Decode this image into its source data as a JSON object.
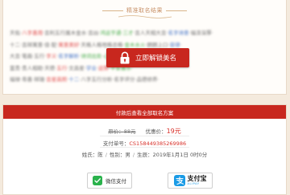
{
  "result": {
    "title": "精准取名结果",
    "blurred_lines": [
      [
        {
          "t": "天佑·",
          "c": ""
        },
        {
          "t": "八字喜用",
          "c": "r"
        },
        {
          "t": "·吉利五行属木金水·吉凶·",
          "c": ""
        },
        {
          "t": "鸿运亨通·三才",
          "c": "g"
        },
        {
          "t": "·吉人天相大吉·",
          "c": ""
        },
        {
          "t": "名字诗意",
          "c": "b"
        },
        {
          "t": "·福泽深厚·",
          "c": ""
        }
      ],
      [
        {
          "t": "十二·吉祥寓意·佳·配·",
          "c": ""
        },
        {
          "t": "寓意美好",
          "c": "r"
        },
        {
          "t": "·天格人格地格总格·",
          "c": ""
        },
        {
          "t": "金木水火",
          "c": "g"
        },
        {
          "t": "·朗朗上口·",
          "c": ""
        },
        {
          "t": "音律",
          "c": "b"
        },
        {
          "t": "·",
          "c": ""
        }
      ],
      [
        {
          "t": "大吉·笔画·五行·",
          "c": ""
        },
        {
          "t": "字义",
          "c": "r"
        },
        {
          "t": "·",
          "c": ""
        },
        {
          "t": "名字解析",
          "c": "b"
        },
        {
          "t": "·",
          "c": ""
        },
        {
          "t": "诗词出处",
          "c": "g"
        },
        {
          "t": "·",
          "c": ""
        },
        {
          "t": "心想事成",
          "c": "g"
        },
        {
          "t": "·",
          "c": ""
        }
      ],
      [
        {
          "t": "富贵·贵人相助·天德·",
          "c": ""
        },
        {
          "t": "五行",
          "c": "r"
        },
        {
          "t": "·文昌星·",
          "c": ""
        },
        {
          "t": "学业",
          "c": "b"
        },
        {
          "t": "·",
          "c": ""
        },
        {
          "t": "运势",
          "c": "r"
        },
        {
          "t": "·",
          "c": ""
        },
        {
          "t": "平安喜乐",
          "c": "g"
        },
        {
          "t": "·",
          "c": ""
        }
      ],
      [
        {
          "t": "福禄·寿喜·祥瑞·",
          "c": ""
        },
        {
          "t": "吉星高照",
          "c": "r"
        },
        {
          "t": "·",
          "c": ""
        },
        {
          "t": "十二",
          "c": "b"
        },
        {
          "t": "·八字五行分析·名字评分·品德修养·",
          "c": ""
        }
      ]
    ],
    "unlock_button": "立即解锁美名"
  },
  "payment": {
    "header": "付款后查看全部取名方案",
    "original_label": "原价：",
    "original_price": "88元",
    "sale_label": "优惠价：",
    "sale_price": "19元",
    "order_label": "支付单号：",
    "order_no": "CS158449385269986",
    "surname_label": "姓氏：",
    "surname": "陈",
    "gender_label": "性别：",
    "gender": "男",
    "birth_label": "生辰：",
    "birth": "2019年1月1日 0时0分",
    "wechat_label": "微信支付",
    "alipay_label": "支付宝",
    "alipay_sub": "ALIPAY"
  },
  "colors": {
    "accent_red": "#c8271e",
    "price_red": "#d8312a",
    "background": "#f4eadd",
    "wechat_green": "#2ab24c",
    "alipay_blue": "#1a9be6"
  },
  "icons": [
    "lock-icon",
    "wechat-pay-icon",
    "alipay-icon"
  ]
}
